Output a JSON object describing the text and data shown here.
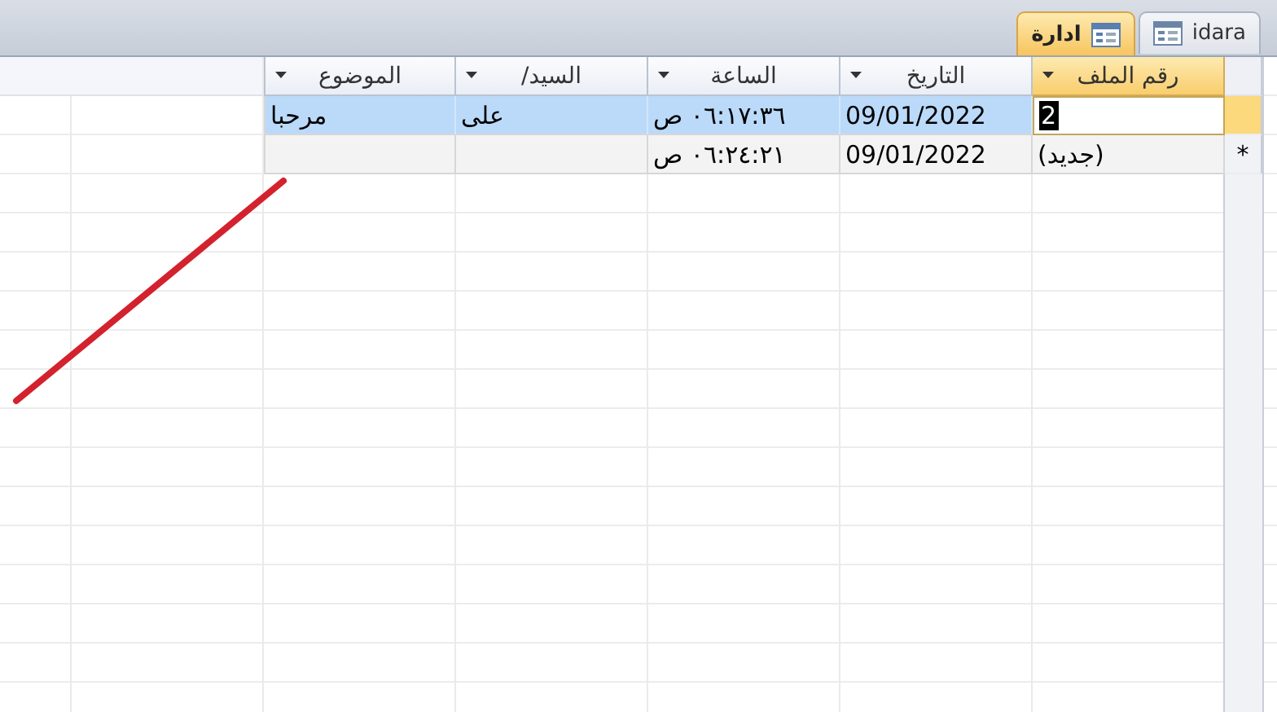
{
  "tabs": [
    {
      "label": "idara",
      "selected": false
    },
    {
      "label": "ادارة",
      "selected": true
    }
  ],
  "table": {
    "columns": [
      {
        "label": "رقم الملف",
        "selected": true
      },
      {
        "label": "التاريخ",
        "selected": false
      },
      {
        "label": "الساعة",
        "selected": false
      },
      {
        "label": "السيد/",
        "selected": false
      },
      {
        "label": "الموضوع",
        "selected": false
      }
    ],
    "rows": [
      {
        "kind": "record",
        "selected": true,
        "cells": [
          "2",
          "09/01/2022",
          "٠٦:١٧:٣٦ ص",
          "على",
          "مرحبا"
        ]
      },
      {
        "kind": "new",
        "selected": false,
        "marker": "*",
        "cells": [
          "(جديد)",
          "09/01/2022",
          "٠٦:٢٤:٢١ ص",
          null,
          null
        ]
      }
    ]
  }
}
